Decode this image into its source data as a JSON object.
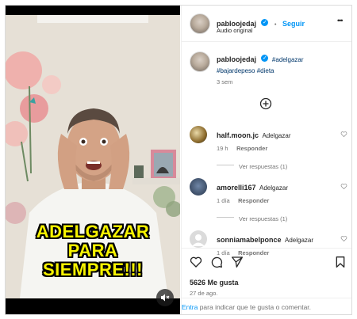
{
  "post": {
    "author": "pabloojedaj",
    "follow_label": "Seguir",
    "separator": "•",
    "audio": "Audio original",
    "more": "•••",
    "caption_tags": "#adelgazar",
    "caption_tags_2": "#bajardepeso #dieta",
    "caption_time": "3 sem",
    "likes": "5626 Me gusta",
    "date": "27 de ago.",
    "add_comment_link": "Entra",
    "add_comment_rest": " para indicar que te gusta o comentar."
  },
  "video": {
    "overlay_text_1": "ADELGAZAR",
    "overlay_text_2": "PARA",
    "overlay_text_3": "SIEMPRE!!!"
  },
  "comments": [
    {
      "user": "half.moon.jc",
      "text": "Adelgazar",
      "time": "19 h",
      "reply": "Responder",
      "view_replies": "Ver respuestas (1)"
    },
    {
      "user": "amorelli167",
      "text": "Adelgazar",
      "time": "1 día",
      "reply": "Responder",
      "view_replies": "Ver respuestas (1)"
    },
    {
      "user": "sonniamabelponce",
      "text": "Adelgazar",
      "time": "1 día",
      "reply": "Responder"
    }
  ],
  "colors": {
    "accent": "#0095f6",
    "caption_yellow": "#f7f300",
    "text": "#262626",
    "muted": "#737373"
  },
  "icons": [
    "verified-badge-icon",
    "more-icon",
    "add-circle-icon",
    "heart-icon",
    "comment-icon",
    "share-icon",
    "bookmark-icon",
    "audio-off-icon"
  ]
}
